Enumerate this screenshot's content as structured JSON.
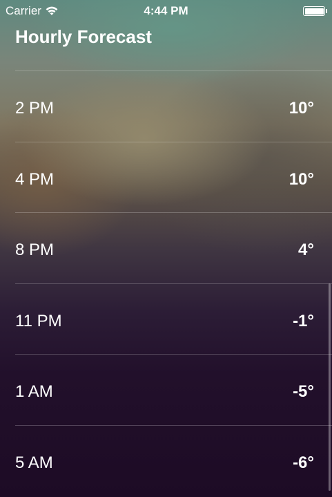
{
  "status_bar": {
    "carrier": "Carrier",
    "time": "4:44 PM"
  },
  "header": {
    "title": "Hourly Forecast"
  },
  "forecast": [
    {
      "hour": "2 PM",
      "temp": "10°"
    },
    {
      "hour": "4 PM",
      "temp": "10°"
    },
    {
      "hour": "8 PM",
      "temp": "4°"
    },
    {
      "hour": "11 PM",
      "temp": "-1°"
    },
    {
      "hour": "1 AM",
      "temp": "-5°"
    },
    {
      "hour": "5 AM",
      "temp": "-6°"
    }
  ],
  "colors": {
    "text": "#ffffff",
    "separator": "rgba(255,255,255,0.22)"
  }
}
